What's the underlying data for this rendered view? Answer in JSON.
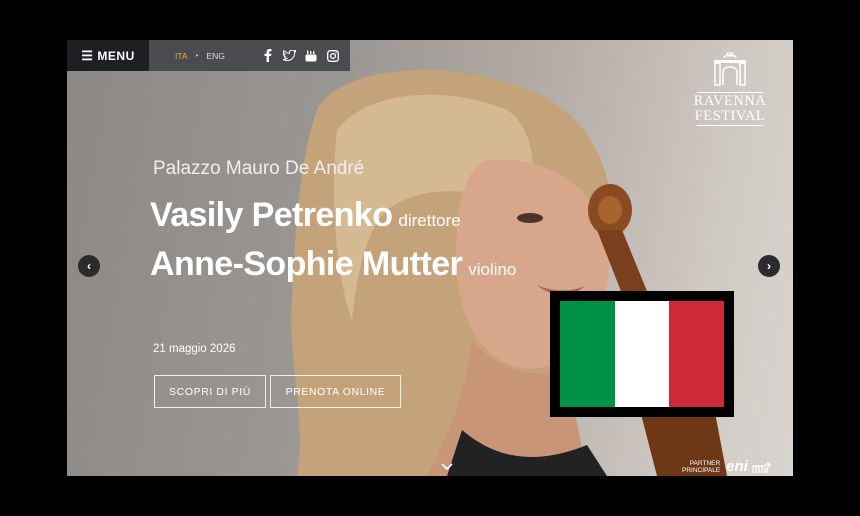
{
  "topbar": {
    "menu_label": "MENU",
    "languages": [
      "ITA",
      "ENG"
    ],
    "active_language": "ITA",
    "separator": "•",
    "socials": [
      "facebook-icon",
      "twitter-icon",
      "youtube-icon",
      "instagram-icon"
    ]
  },
  "logo": {
    "line1": "RAVENNA",
    "line2": "FESTIVAL"
  },
  "hero": {
    "venue": "Palazzo Mauro De André",
    "performers": [
      {
        "name": "Vasily Petrenko",
        "role": "direttore"
      },
      {
        "name": "Anne-Sophie Mutter",
        "role": "violino"
      }
    ],
    "date": "21 maggio 2026",
    "buttons": {
      "more": "SCOPRI DI PIÙ",
      "book": "PRENOTA ONLINE"
    }
  },
  "sponsor": {
    "label_line1": "PARTNER",
    "label_line2": "PRINCIPALE",
    "name": "eni"
  },
  "flag": {
    "colors": [
      "#009246",
      "#ffffff",
      "#ce2b37"
    ]
  },
  "colors": {
    "accent": "#f5a23a",
    "menu_bg": "#1d1f22",
    "lang_bg": "#4b4c4f"
  }
}
